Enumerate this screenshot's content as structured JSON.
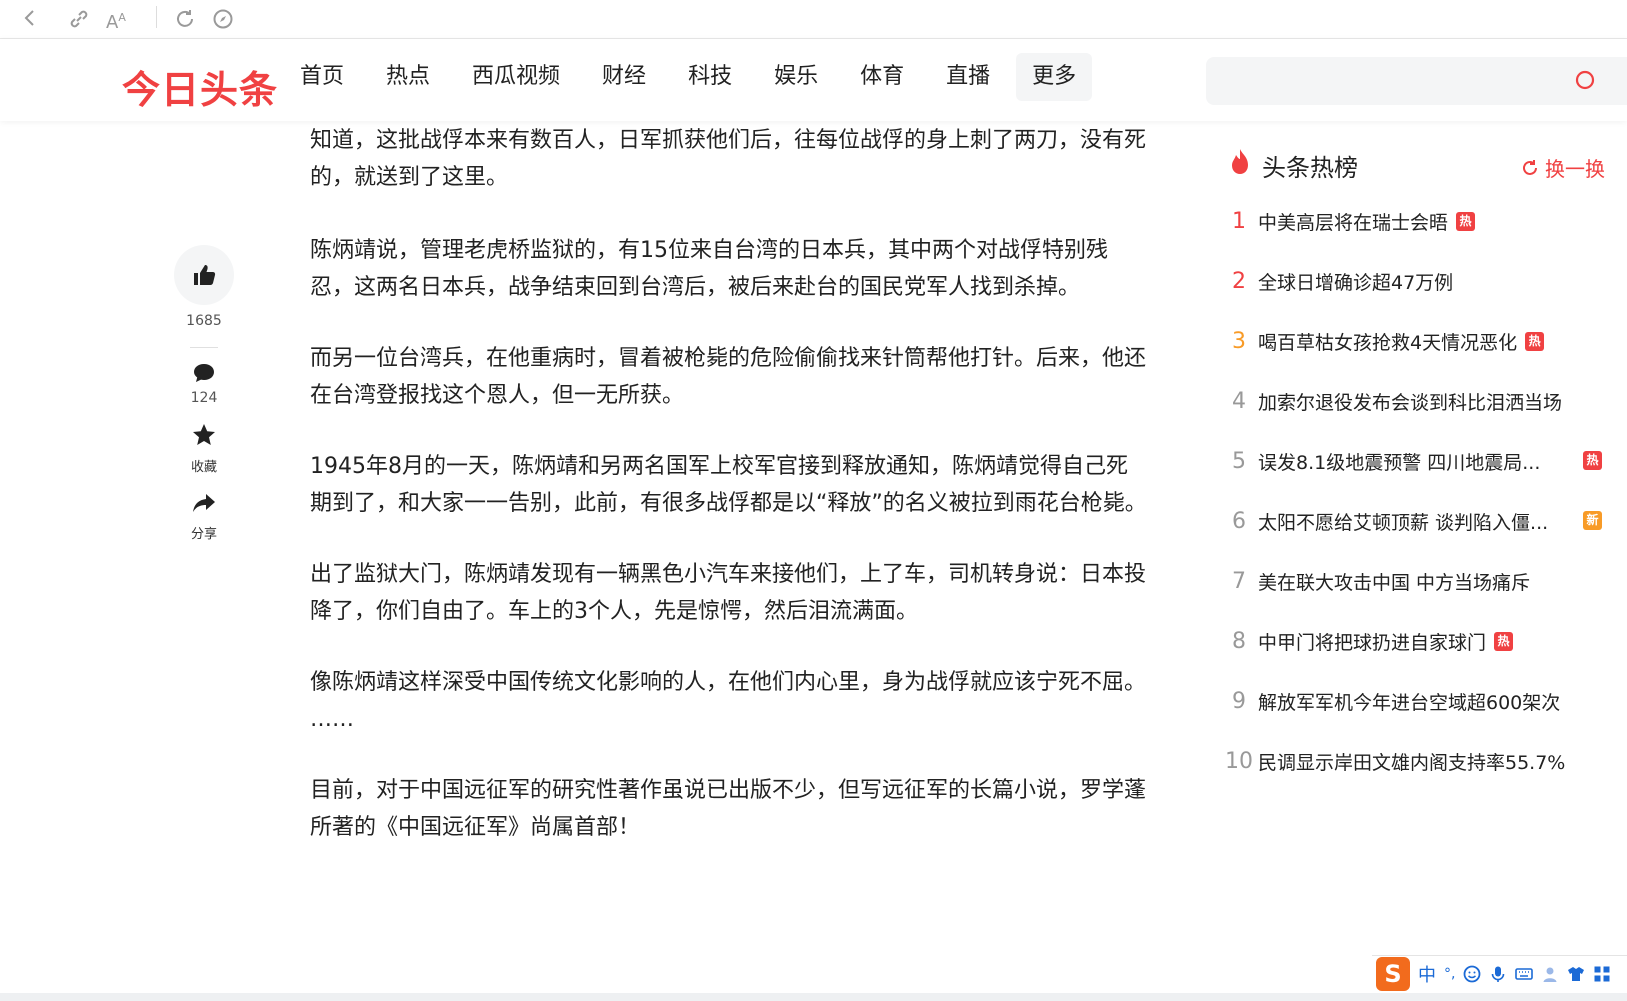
{
  "browser": {
    "icons": [
      "back-icon",
      "link-icon",
      "text-size-icon",
      "reload-icon",
      "compass-icon"
    ]
  },
  "header": {
    "logo": "今日头条",
    "nav": [
      "首页",
      "热点",
      "西瓜视频",
      "财经",
      "科技",
      "娱乐",
      "体育",
      "直播"
    ],
    "more": "更多",
    "search_placeholder": ""
  },
  "article": {
    "paragraphs": [
      "知道，这批战俘本来有数百人，日军抓获他们后，往每位战俘的身上刺了两刀，没有死的，就送到了这里。",
      "陈炳靖说，管理老虎桥监狱的，有15位来自台湾的日本兵，其中两个对战俘特别残忍，这两名日本兵，战争结束回到台湾后，被后来赴台的国民党军人找到杀掉。",
      "而另一位台湾兵，在他重病时，冒着被枪毙的危险偷偷找来针筒帮他打针。后来，他还在台湾登报找这个恩人，但一无所获。",
      "1945年8月的一天，陈炳靖和另两名国军上校军官接到释放通知，陈炳靖觉得自己死期到了，和大家一一告别，此前，有很多战俘都是以“释放”的名义被拉到雨花台枪毙。",
      "出了监狱大门，陈炳靖发现有一辆黑色小汽车来接他们，上了车，司机转身说：日本投降了，你们自由了。车上的3个人，先是惊愕，然后泪流满面。",
      "像陈炳靖这样深受中国传统文化影响的人，在他们内心里，身为战俘就应该宁死不屈。",
      "……",
      "目前，对于中国远征军的研究性著作虽说已出版不少，但写远征军的长篇小说，罗学蓬所著的《中国远征军》尚属首部！"
    ]
  },
  "actions": {
    "like_count": "1685",
    "comment_count": "124",
    "favorite_label": "收藏",
    "share_label": "分享"
  },
  "sidebar": {
    "title": "头条热榜",
    "refresh": "换一换",
    "items": [
      {
        "rank": "1",
        "text": "中美高层将在瑞士会晤",
        "badge": "热"
      },
      {
        "rank": "2",
        "text": "全球日增确诊超47万例",
        "badge": ""
      },
      {
        "rank": "3",
        "text": "喝百草枯女孩抢救4天情况恶化",
        "badge": "热"
      },
      {
        "rank": "4",
        "text": "加索尔退役发布会谈到科比泪洒当场",
        "badge": ""
      },
      {
        "rank": "5",
        "text": "误发8.1级地震预警 四川地震局...",
        "badge": "热"
      },
      {
        "rank": "6",
        "text": "太阳不愿给艾顿顶薪 谈判陷入僵...",
        "badge": "新"
      },
      {
        "rank": "7",
        "text": "美在联大攻击中国 中方当场痛斥",
        "badge": ""
      },
      {
        "rank": "8",
        "text": "中甲门将把球扔进自家球门",
        "badge": "热"
      },
      {
        "rank": "9",
        "text": "解放军军机今年进台空域超600架次",
        "badge": ""
      },
      {
        "rank": "10",
        "text": "民调显示岸田文雄内阁支持率55.7%",
        "badge": ""
      }
    ]
  },
  "ime": {
    "logo": "S",
    "mode": "中",
    "punct": "°,"
  },
  "colors": {
    "brand": "#f04142",
    "rank3": "#f89b27",
    "new_badge": "#f89b27"
  }
}
